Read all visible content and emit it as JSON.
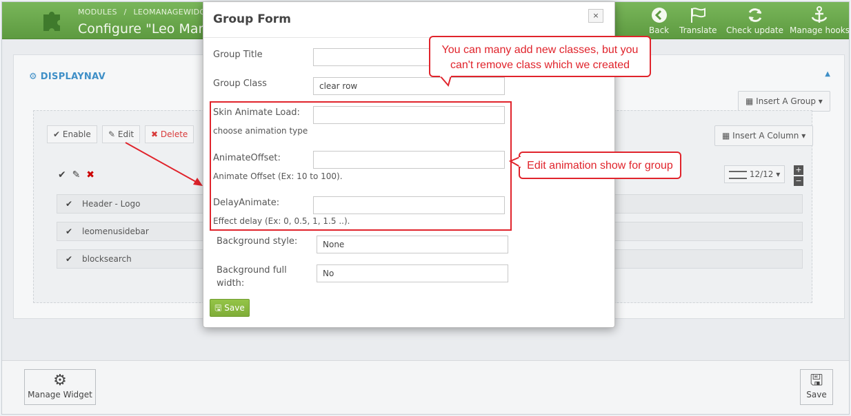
{
  "header": {
    "crumbs": [
      "MODULES",
      "/",
      "LEOMANAGEWIDG"
    ],
    "title": "Configure \"Leo Mana",
    "actions": [
      {
        "label": "Back",
        "icon": "back-arrow-icon"
      },
      {
        "label": "Translate",
        "icon": "flag-icon"
      },
      {
        "label": "Check update",
        "icon": "refresh-icon"
      },
      {
        "label": "Manage hooks",
        "icon": "anchor-icon"
      }
    ]
  },
  "panel": {
    "title": "DISPLAYNAV",
    "insert_group": "Insert A Group",
    "insert_column": "Insert A Column",
    "toolbar": {
      "enable": "Enable",
      "edit": "Edit",
      "delete": "Delete"
    },
    "column_size": "12/12",
    "rows": [
      "Header - Logo",
      "leomenusidebar",
      "blocksearch"
    ]
  },
  "bottom": {
    "manage_widget": "Manage Widget",
    "save": "Save"
  },
  "modal": {
    "title": "Group Form",
    "close": "×",
    "fields": {
      "group_title_label": "Group Title",
      "group_title_value": "",
      "group_class_label": "Group Class",
      "group_class_value": "clear row",
      "skin_animate_label": "Skin Animate Load:",
      "skin_animate_help": "choose animation type",
      "animate_offset_label": "AnimateOffset:",
      "animate_offset_help": "Animate Offset (Ex: 10 to 100).",
      "delay_animate_label": "DelayAnimate:",
      "delay_animate_help": "Effect delay (Ex: 0, 0.5, 1, 1.5 ..).",
      "background_style_label": "Background style:",
      "background_style_value": "None",
      "background_full_label_1": "Background full",
      "background_full_label_2": "width:",
      "background_full_value": "No"
    },
    "save": "Save"
  },
  "callouts": {
    "classes_line1": "You can many add new classes, but you",
    "classes_line2": "can't remove class which we created",
    "animation": "Edit animation show for group"
  },
  "colors": {
    "header_green": "#6aa84f",
    "accent_blue": "#3f8fc7",
    "annotation_red": "#e0232b",
    "save_green": "#8bbb3f"
  }
}
